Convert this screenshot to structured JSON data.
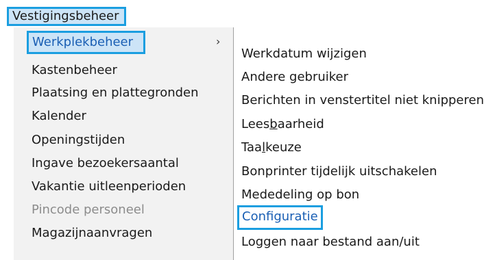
{
  "menubar": {
    "label": "Vestigingsbeheer"
  },
  "submenu": {
    "arrow": "›",
    "items": [
      {
        "label": "Werkplekbeheer"
      },
      {
        "label": "Kastenbeheer"
      },
      {
        "label": "Plaatsing en plattegronden"
      },
      {
        "label": "Kalender"
      },
      {
        "label": "Openingstijden"
      },
      {
        "label": "Ingave bezoekersaantal"
      },
      {
        "label": "Vakantie uitleenperioden"
      },
      {
        "label": "Pincode personeel"
      },
      {
        "label": "Magazijnaanvragen"
      }
    ]
  },
  "flyout": {
    "items": [
      {
        "label": "Werkdatum wijzigen"
      },
      {
        "label": "Andere gebruiker"
      },
      {
        "label": "Berichten in venstertitel niet knipperen"
      },
      {
        "label_pre": "Lees",
        "label_accel": "b",
        "label_post": "aarheid"
      },
      {
        "label_pre": "Taa",
        "label_accel": "l",
        "label_post": "keuze"
      },
      {
        "label": "Bonprinter tijdelijk uitschakelen"
      },
      {
        "label": "Mededeling op bon"
      },
      {
        "label": "Configuratie"
      },
      {
        "label": "Loggen naar bestand aan/uit"
      }
    ]
  },
  "colors": {
    "highlight_border": "#1a9ee0",
    "highlight_fill": "#cce4f7",
    "selected_text": "#1a5fb4",
    "disabled_text": "#8c8c8c"
  }
}
